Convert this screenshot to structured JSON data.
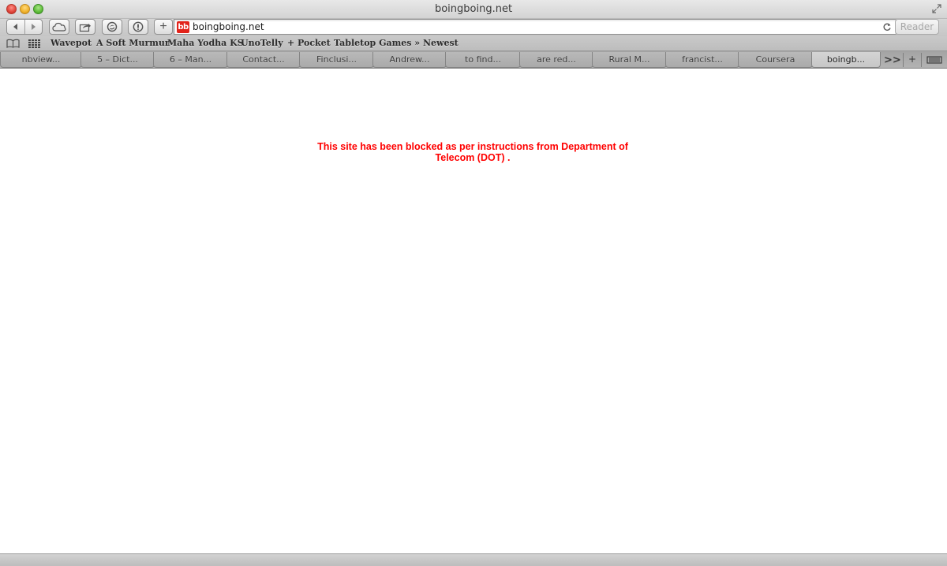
{
  "window": {
    "title": "boingboing.net"
  },
  "toolbar": {
    "add_label": "+",
    "url": "boingboing.net",
    "favicon_text": "bb",
    "favicon_color": "#e2231a",
    "reader_label": "Reader",
    "icons": [
      "back-arrow-icon",
      "forward-arrow-icon",
      "icloud-tabs-icon",
      "share-icon",
      "readlater-icon",
      "pocket-icon",
      "reload-icon"
    ]
  },
  "bookmarks": {
    "items": [
      "Wavepot",
      "A Soft Murmur",
      "Maha Yodha KS",
      "UnoTelly",
      "+ Pocket",
      "Tabletop Games » Newest"
    ]
  },
  "tabs": {
    "items": [
      {
        "label": "nbview..."
      },
      {
        "label": "5 – Dict..."
      },
      {
        "label": "6 – Man..."
      },
      {
        "label": "Contact..."
      },
      {
        "label": "Finclusi..."
      },
      {
        "label": "Andrew..."
      },
      {
        "label": "to find..."
      },
      {
        "label": "are red..."
      },
      {
        "label": "Rural M..."
      },
      {
        "label": "francist..."
      },
      {
        "label": "Coursera"
      },
      {
        "label": "boingb..."
      }
    ],
    "active_index": 11,
    "overflow_label": ">>",
    "new_tab_label": "+"
  },
  "content": {
    "message": "This site has been blocked as per instructions from Department of Telecom (DOT) .",
    "message_color": "#ff0000"
  }
}
